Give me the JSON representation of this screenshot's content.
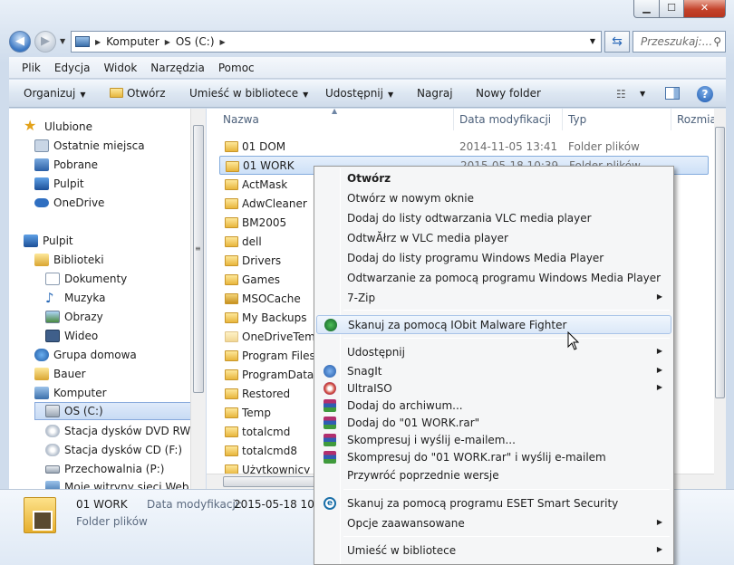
{
  "window": {
    "controls": {
      "minimize": "▁",
      "maximize": "☐",
      "close": "✕"
    }
  },
  "address": {
    "back": "◀",
    "forward": "▶",
    "crumbs": [
      "Komputer",
      "OS (C:)"
    ],
    "search_placeholder": "Przeszukaj:..."
  },
  "menubar": [
    "Plik",
    "Edycja",
    "Widok",
    "Narzędzia",
    "Pomoc"
  ],
  "toolbar": {
    "organize": "Organizuj",
    "open": "Otwórz",
    "include": "Umieść w bibliotece",
    "share": "Udostępnij",
    "burn": "Nagraj",
    "new_folder": "Nowy folder",
    "help": "?"
  },
  "navpane": {
    "favorites_header": "Ulubione",
    "favorites": [
      "Ostatnie miejsca",
      "Pobrane",
      "Pulpit",
      "OneDrive"
    ],
    "desktop": "Pulpit",
    "libraries": "Biblioteki",
    "library_items": [
      "Dokumenty",
      "Muzyka",
      "Obrazy",
      "Wideo"
    ],
    "homegroup": "Grupa domowa",
    "user": "Bauer",
    "computer": "Komputer",
    "drives": [
      "OS (C:)",
      "Stacja dysków DVD RW (D:",
      "Stacja dysków CD (F:)",
      "Przechowalnia (P:)",
      "Moje witryny sieci Web w s"
    ]
  },
  "columns": {
    "name": "Nazwa",
    "date": "Data modyfikacji",
    "type": "Typ",
    "size": "Rozmia"
  },
  "files": [
    {
      "name": "01 DOM",
      "date": "2014-11-05 13:41",
      "type": "Folder plików"
    },
    {
      "name": "01 WORK",
      "date": "2015-05-18 10:39",
      "type": "Folder plików"
    },
    {
      "name": "ActMask",
      "date": "",
      "type": ""
    },
    {
      "name": "AdwCleaner",
      "date": "",
      "type": ""
    },
    {
      "name": "BM2005",
      "date": "",
      "type": ""
    },
    {
      "name": "dell",
      "date": "",
      "type": ""
    },
    {
      "name": "Drivers",
      "date": "",
      "type": ""
    },
    {
      "name": "Games",
      "date": "",
      "type": ""
    },
    {
      "name": "MSOCache",
      "date": "",
      "type": ""
    },
    {
      "name": "My Backups",
      "date": "",
      "type": ""
    },
    {
      "name": "OneDriveTemp",
      "date": "",
      "type": ""
    },
    {
      "name": "Program Files",
      "date": "",
      "type": ""
    },
    {
      "name": "ProgramData",
      "date": "",
      "type": ""
    },
    {
      "name": "Restored",
      "date": "",
      "type": ""
    },
    {
      "name": "Temp",
      "date": "",
      "type": ""
    },
    {
      "name": "totalcmd",
      "date": "",
      "type": ""
    },
    {
      "name": "totalcmd8",
      "date": "",
      "type": ""
    },
    {
      "name": "Użytkownicy",
      "date": "",
      "type": ""
    }
  ],
  "details": {
    "name": "01 WORK",
    "date_label": "Data modyfikacji:",
    "date": "2015-05-18 10:39",
    "type": "Folder plików"
  },
  "context_menu": [
    {
      "label": "Otwórz",
      "bold": true
    },
    {
      "label": "Otwórz w nowym oknie"
    },
    {
      "label": "Dodaj do listy odtwarzania VLC media player"
    },
    {
      "label": "OdtwĂłrz w VLC media player"
    },
    {
      "label": "Dodaj do listy programu Windows Media Player"
    },
    {
      "label": "Odtwarzanie za pomocą programu Windows Media Player"
    },
    {
      "label": "7-Zip",
      "submenu": true
    },
    {
      "label": "Skanuj za pomocą IObit Malware Fighter",
      "highlight": true
    },
    {
      "label": "Udostępnij",
      "submenu": true
    },
    {
      "label": "SnagIt",
      "submenu": true
    },
    {
      "label": "UltraISO",
      "submenu": true
    },
    {
      "label": "Dodaj do archiwum..."
    },
    {
      "label": "Dodaj do \"01 WORK.rar\""
    },
    {
      "label": "Skompresuj i wyślij e-mailem..."
    },
    {
      "label": "Skompresuj do \"01 WORK.rar\" i wyślij e-mailem"
    },
    {
      "label": "Przywróć poprzednie wersje"
    },
    {
      "label": "Skanuj za pomocą programu ESET Smart Security"
    },
    {
      "label": "Opcje zaawansowane",
      "submenu": true
    },
    {
      "label": "Umieść w bibliotece",
      "submenu": true
    }
  ],
  "colors": {
    "accent": "#3a77c3",
    "selection": "#cde0f7",
    "menu_bg": "#f5f6f7"
  }
}
